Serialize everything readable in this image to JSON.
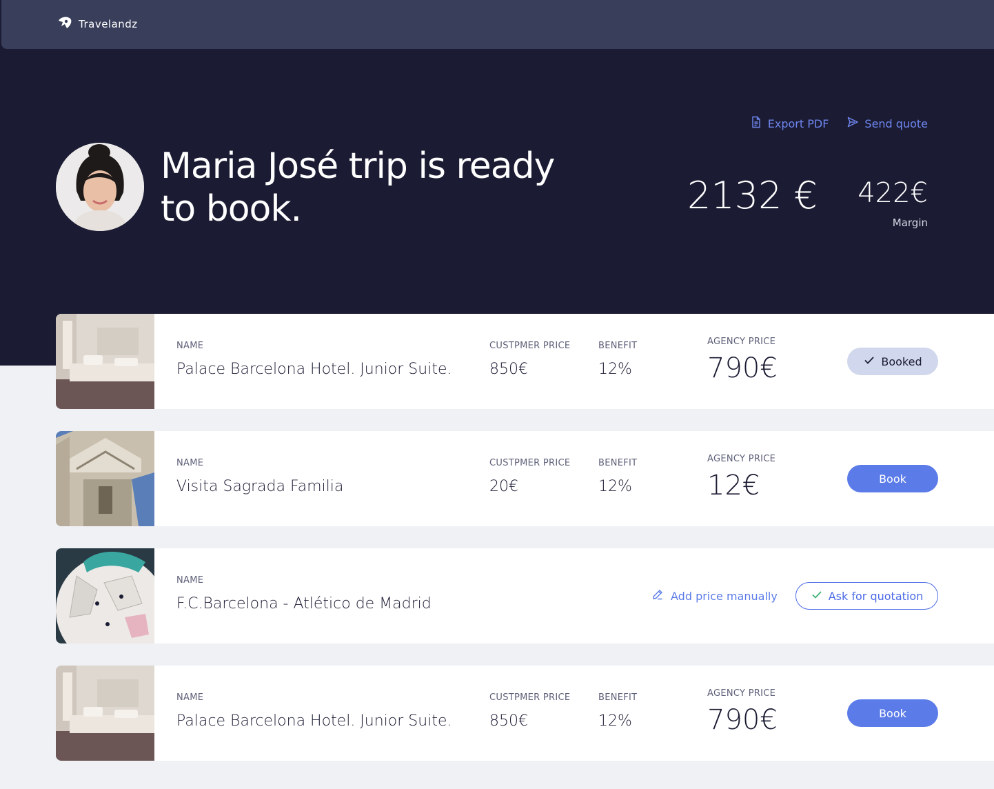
{
  "brand": {
    "name": "Travelandz"
  },
  "header": {
    "actions": {
      "export_label": "Export PDF",
      "send_label": "Send quote"
    },
    "title": "Maria José trip is ready to book.",
    "total": "2132 €",
    "margin_value": "422€",
    "margin_label": "Margin"
  },
  "labels": {
    "name": "NAME",
    "customer_price": "CUSTPMER PRICE",
    "benefit": "BENEFIT",
    "agency_price": "AGENCY PRICE"
  },
  "items": [
    {
      "name": "Palace Barcelona Hotel. Junior Suite.",
      "customer_price": "850€",
      "benefit": "12%",
      "agency_price": "790€",
      "action": "Booked",
      "image": "hotel-room"
    },
    {
      "name": "Visita Sagrada Familia",
      "customer_price": "20€",
      "benefit": "12%",
      "agency_price": "12€",
      "action": "Book",
      "image": "sagrada-familia"
    },
    {
      "name": "F.C.Barcelona - Atlético de Madrid",
      "manual_label": "Add price manually",
      "action": "Ask for quotation",
      "image": "football"
    },
    {
      "name": "Palace Barcelona Hotel. Junior Suite.",
      "customer_price": "850€",
      "benefit": "12%",
      "agency_price": "790€",
      "action": "Book",
      "image": "hotel-room"
    }
  ],
  "colors": {
    "dark": "#1b1c33",
    "topbar": "#393f5b",
    "accent": "#5b7be9",
    "booked_bg": "#d1d7ec",
    "page_bg": "#f0f1f5"
  },
  "icons": {
    "logo": "travelandz-logo-icon",
    "export": "document-icon",
    "send": "send-icon",
    "check": "check-icon",
    "pencil": "pencil-icon"
  }
}
